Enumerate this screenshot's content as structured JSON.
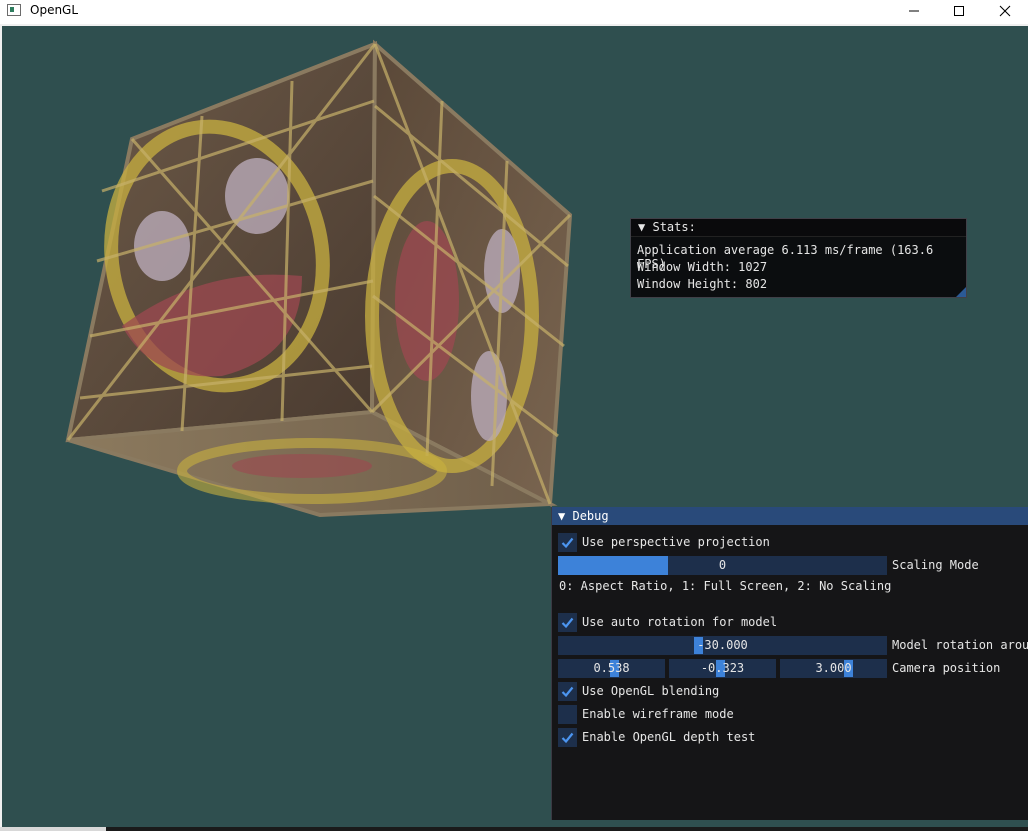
{
  "window": {
    "title": "OpenGL",
    "minimize_icon": "minimize-icon",
    "maximize_icon": "maximize-icon",
    "close_icon": "close-icon"
  },
  "scene": {
    "background_color": "#2f4f4f"
  },
  "stats_panel": {
    "title": "Stats:",
    "fps_line": "Application average 6.113 ms/frame (163.6 FPS)",
    "width_line": "Window Width: 1027",
    "height_line": "Window Height: 802"
  },
  "debug_panel": {
    "title": "Debug",
    "perspective": {
      "label": "Use perspective projection",
      "checked": true
    },
    "scaling": {
      "value": "0",
      "label": "Scaling Mode",
      "fill": 0.33
    },
    "scaling_help": "0: Aspect Ratio, 1: Full Screen, 2: No Scaling",
    "auto_rotation": {
      "label": "Use auto rotation for model",
      "checked": true
    },
    "rotation": {
      "value": "-30.000",
      "label": "Model rotation arour"
    },
    "camera": {
      "x": "0.538",
      "y": "-0.323",
      "z": "3.000",
      "label": "Camera position"
    },
    "blending": {
      "label": "Use OpenGL blending",
      "checked": true
    },
    "wireframe": {
      "label": "Enable wireframe mode",
      "checked": false
    },
    "depth_test": {
      "label": "Enable OpenGL depth test",
      "checked": true
    }
  },
  "colors": {
    "accent": "#3d82d9",
    "frame_bg": "#1d2f4b",
    "header": "#294a7a"
  }
}
